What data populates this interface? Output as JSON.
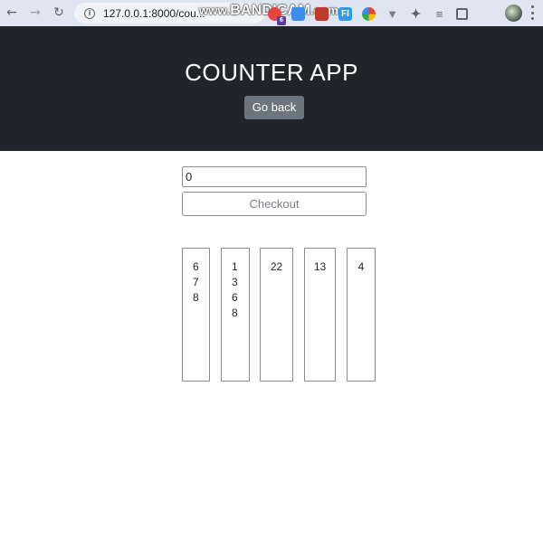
{
  "browser": {
    "url": "127.0.0.1:8000/cou...",
    "watermark_prefix": "www.",
    "watermark_brand": "BANDICAM",
    "watermark_suffix": ".com",
    "extension_badge": "6",
    "ext_fi_label": "FI"
  },
  "header": {
    "title": "COUNTER APP",
    "go_back_label": "Go back",
    "background": "#212429"
  },
  "main": {
    "count_value": "0",
    "checkout_label": "Checkout"
  },
  "columns": [
    {
      "values": [
        "6",
        "7",
        "8"
      ]
    },
    {
      "values": [
        "1",
        "3",
        "6",
        "8"
      ]
    },
    {
      "values": [
        "22"
      ]
    },
    {
      "values": [
        "13"
      ]
    },
    {
      "values": [
        "4"
      ]
    }
  ]
}
